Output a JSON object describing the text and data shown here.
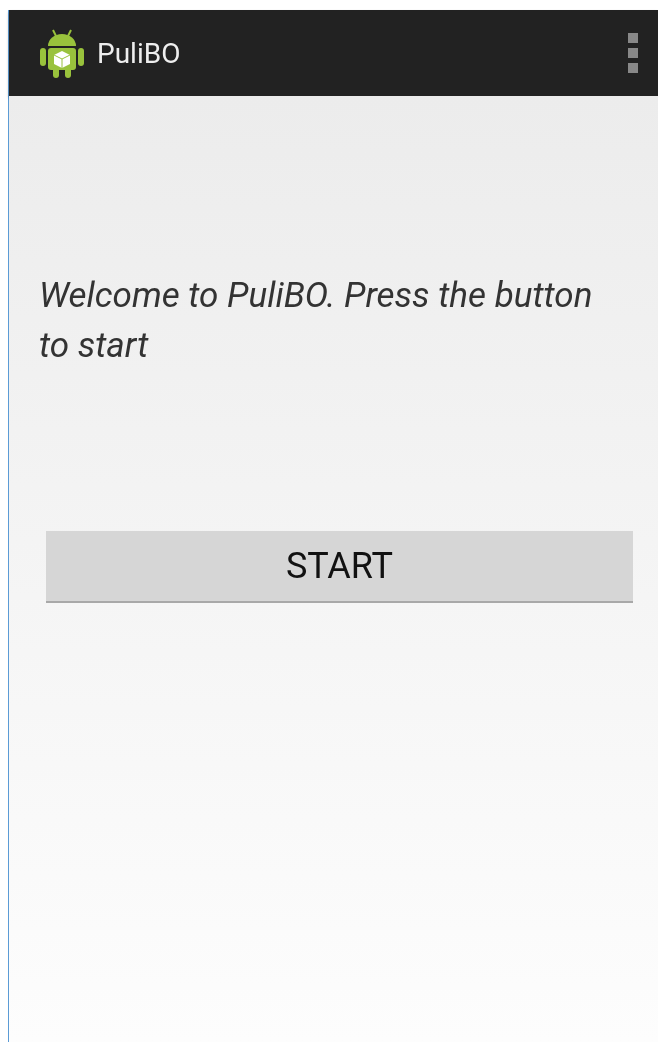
{
  "action_bar": {
    "title": "PuliBO"
  },
  "content": {
    "welcome_text": "Welcome to PuliBO. Press the button to start",
    "start_button": "START"
  }
}
